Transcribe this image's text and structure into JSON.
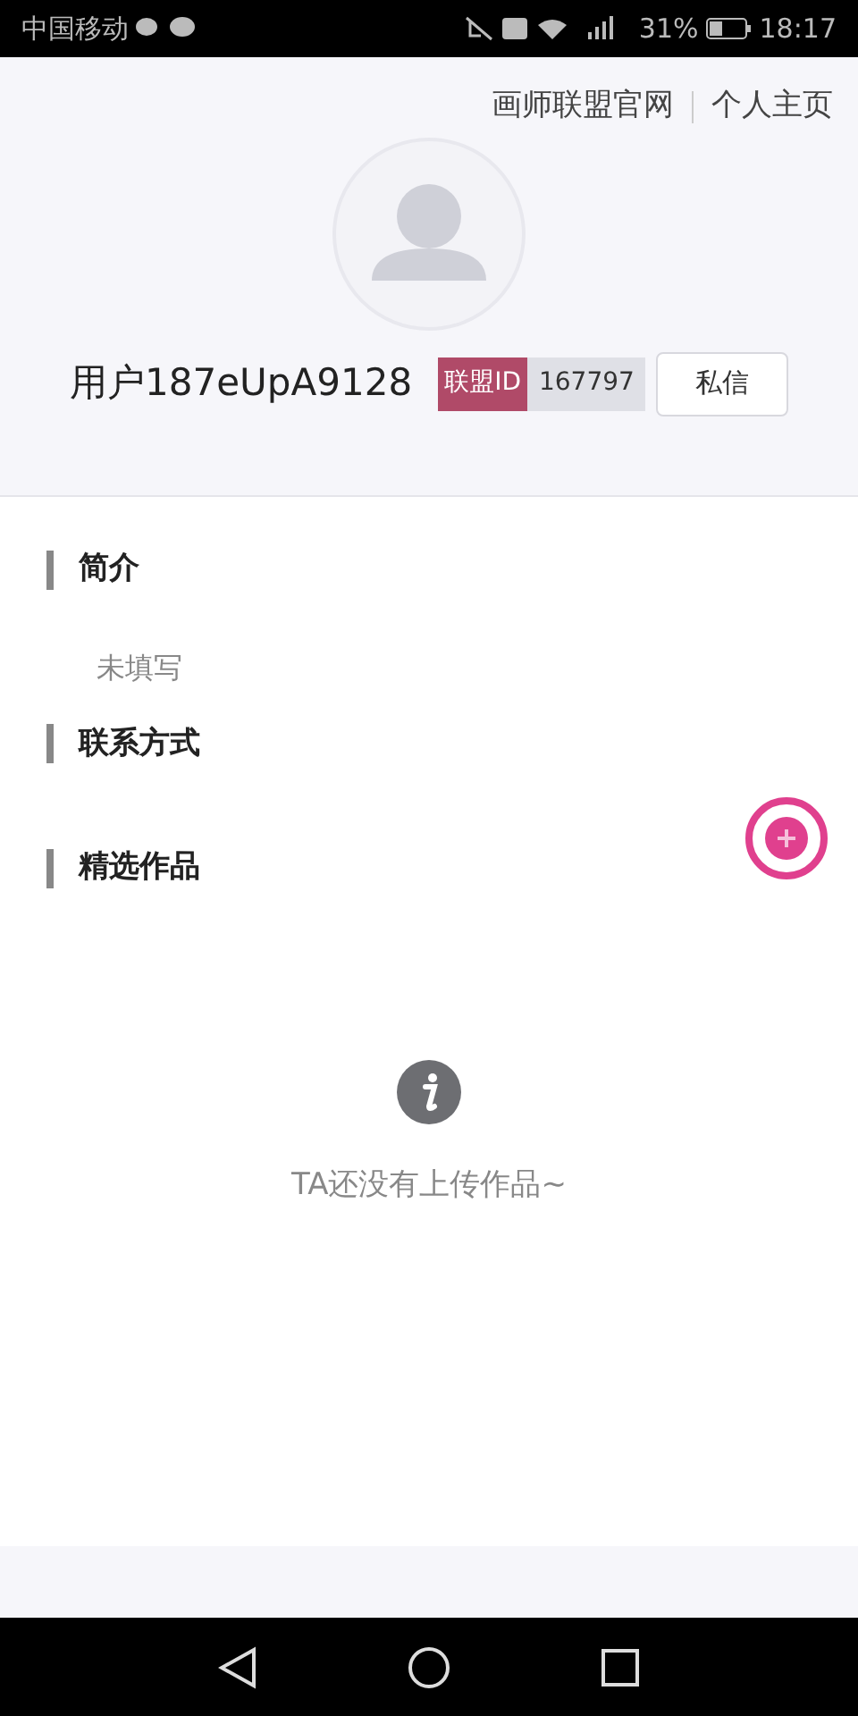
{
  "status_bar": {
    "carrier": "中国移动",
    "battery": "31%",
    "time": "18:17"
  },
  "header_links": [
    "画师联盟官网",
    "个人主页"
  ],
  "profile": {
    "username": "用户187eUpA9128",
    "id_label": "联盟ID",
    "id_value": "167797",
    "message_button": "私信"
  },
  "sections": [
    {
      "title": "简介",
      "content": "未填写"
    },
    {
      "title": "联系方式"
    },
    {
      "title": "精选作品"
    }
  ],
  "empty_state": {
    "message": "TA还没有上传作品~"
  }
}
